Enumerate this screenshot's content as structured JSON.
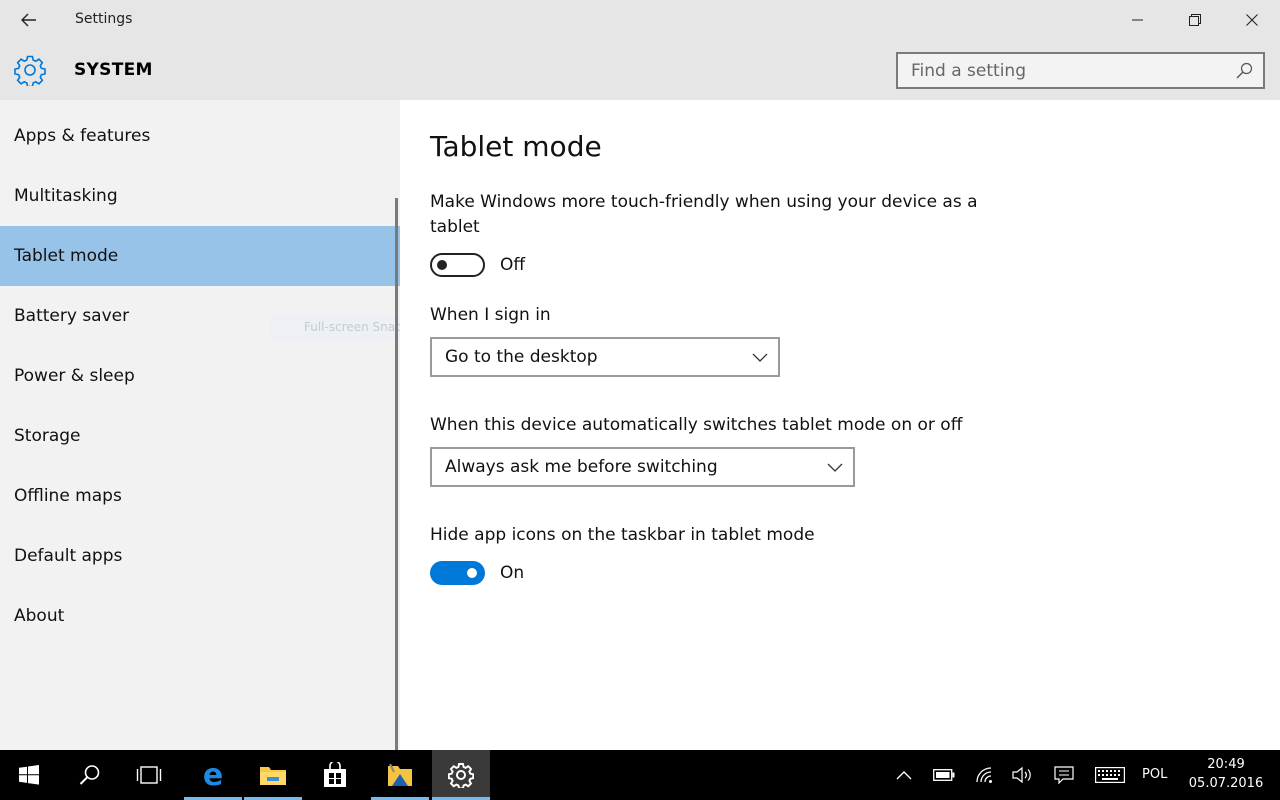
{
  "window": {
    "app_title": "Settings",
    "section_title": "SYSTEM"
  },
  "search": {
    "placeholder": "Find a setting"
  },
  "sidebar": {
    "items": [
      {
        "label": "Apps & features"
      },
      {
        "label": "Multitasking"
      },
      {
        "label": "Tablet mode",
        "selected": true
      },
      {
        "label": "Battery saver"
      },
      {
        "label": "Power & sleep"
      },
      {
        "label": "Storage"
      },
      {
        "label": "Offline maps"
      },
      {
        "label": "Default apps"
      },
      {
        "label": "About"
      }
    ],
    "snap_hint": "Full-screen Snap"
  },
  "main": {
    "title": "Tablet mode",
    "touch_friendly": {
      "description": "Make Windows more touch-friendly when using your device as a tablet",
      "state": "Off"
    },
    "sign_in": {
      "label": "When I sign in",
      "value": "Go to the desktop"
    },
    "auto_switch": {
      "label": "When this device automatically switches tablet mode on or off",
      "value": "Always ask me before switching"
    },
    "hide_icons": {
      "description": "Hide app icons on the taskbar in tablet mode",
      "state": "On"
    }
  },
  "taskbar": {
    "apps": [
      "start",
      "search",
      "task-view",
      "edge",
      "file-explorer",
      "store",
      "folder-app",
      "settings"
    ],
    "language": "POL",
    "time": "20:49",
    "date": "05.07.2016"
  },
  "colors": {
    "accent": "#0078d7",
    "selected_nav": "#98c3e9",
    "chrome": "#e6e6e6",
    "sidebar_bg": "#f2f2f2"
  }
}
